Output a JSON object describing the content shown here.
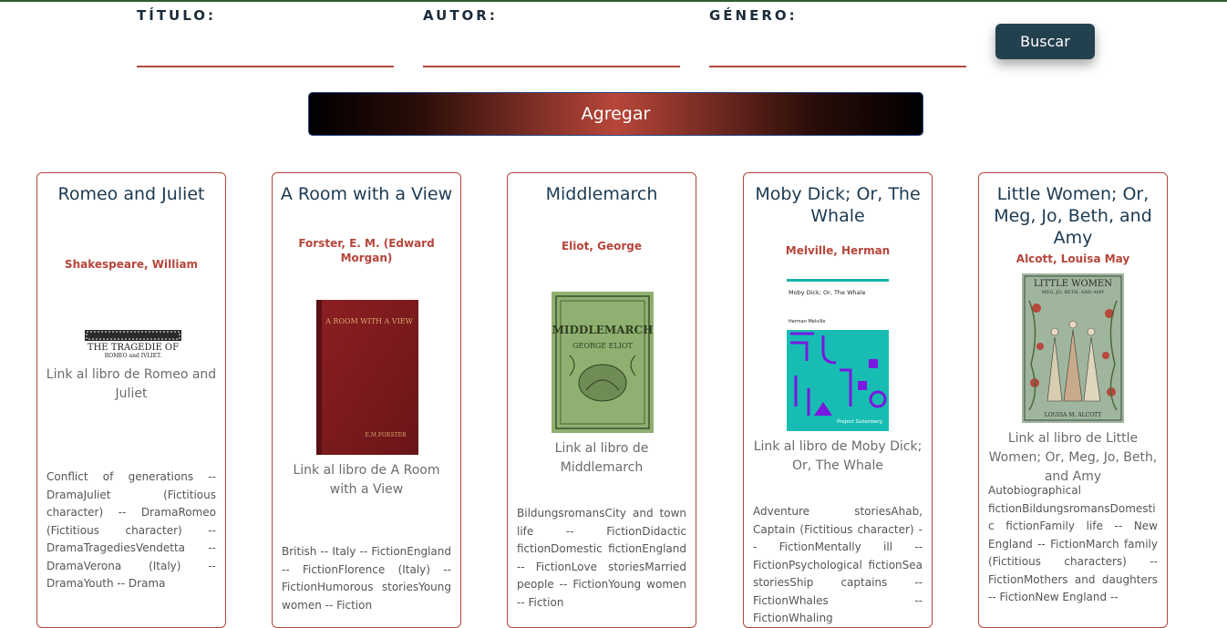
{
  "search": {
    "fields": [
      {
        "label": "TÍTULO:",
        "value": ""
      },
      {
        "label": "AUTOR:",
        "value": ""
      },
      {
        "label": "GÉNERO:",
        "value": ""
      }
    ],
    "buscar_label": "Buscar",
    "agregar_label": "Agregar"
  },
  "colors": {
    "title": "#1c3a52",
    "author": "#b5453a",
    "card_border": "#b5453a",
    "buscar_bg": "#23404f",
    "agregar_center": "#b8463a"
  },
  "books": [
    {
      "title": "Romeo and Juliet",
      "author": "Shakespeare, William",
      "cover_text": [
        "THE TRAGEDIE OF",
        "ROMEO and IVLIET."
      ],
      "link": "Link al libro de Romeo and Juliet",
      "subjects": "Conflict of generations -- DramaJuliet (Fictitious character) -- DramaRomeo (Fictitious character) -- DramaTragediesVendetta -- DramaVerona (Italy) -- DramaYouth -- Drama"
    },
    {
      "title": "A Room with a View",
      "author": "Forster, E. M. (Edward Morgan)",
      "cover_text": [
        "A ROOM WITH A VIEW",
        "E.M.FORSTER"
      ],
      "link": "Link al libro de A Room with a View",
      "subjects": "British -- Italy -- FictionEngland -- FictionFlorence (Italy) -- FictionHumorous storiesYoung women -- Fiction"
    },
    {
      "title": "Middlemarch",
      "author": "Eliot, George",
      "cover_text": [
        "MIDDLEMARCH",
        "GEORGE ELIOT"
      ],
      "link": "Link al libro de Middlemarch",
      "subjects": "BildungsromansCity and town life -- FictionDidactic fictionDomestic fictionEngland -- FictionLove storiesMarried people -- FictionYoung women -- Fiction"
    },
    {
      "title": "Moby Dick; Or, The Whale",
      "author": "Melville, Herman",
      "cover_text": [
        "Moby Dick; Or, The Whale",
        "Herman Melville",
        "Project Gutenberg"
      ],
      "link": "Link al libro de Moby Dick; Or, The Whale",
      "subjects": "Adventure storiesAhab, Captain (Fictitious character) -- FictionMentally ill -- FictionPsychological fictionSea storiesShip captains -- FictionWhales -- FictionWhaling"
    },
    {
      "title": "Little Women; Or, Meg, Jo, Beth, and Amy",
      "author": "Alcott, Louisa May",
      "cover_text": [
        "LITTLE WOMEN",
        "MEG, JO, BETH, AND AMY",
        "LOUISA M. ALCOTT"
      ],
      "link": "Link al libro de Little Women; Or, Meg, Jo, Beth, and Amy",
      "subjects": "Autobiographical fictionBildungsromansDomestic fictionFamily life -- New England -- FictionMarch family (Fictitious characters) -- FictionMothers and daughters -- FictionNew England --"
    }
  ]
}
